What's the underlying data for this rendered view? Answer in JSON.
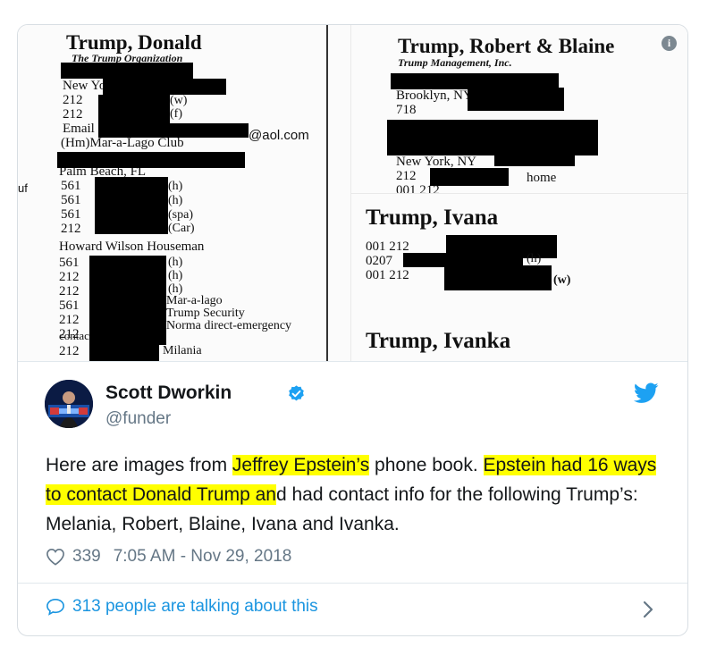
{
  "media": {
    "left": {
      "name": "Trump, Donald",
      "org": "The Trump Organization",
      "lines": [
        "New York, NY",
        "212",
        "212",
        "Email",
        "(Hm)Mar-a-Lago Club",
        "Palm Beach, FL",
        "561",
        "561",
        "561",
        "212",
        "Howard Wilson Houseman",
        "561",
        "212",
        "212",
        "561",
        "212",
        "212",
        "contact",
        "212"
      ],
      "tags": [
        "@aol.com",
        "(w)",
        "(f)",
        "(h)",
        "(h)",
        "(spa)",
        "(Car)",
        "(h)",
        "(h)",
        "(h)",
        "Mar-a-lago",
        "Trump Security",
        "Norma direct-emergency",
        "Milania"
      ],
      "margin": "uf"
    },
    "top_right": {
      "name": "Trump, Robert & Blaine",
      "org": "Trump Management, Inc.",
      "lines": [
        "Brooklyn, NY",
        "718",
        "New York, NY",
        "212",
        "001 212"
      ],
      "tags": [
        "home"
      ]
    },
    "bottom_right": {
      "name1": "Trump, Ivana",
      "lines": [
        "001 212",
        "0207",
        "001 212"
      ],
      "tags": [
        "(h)",
        "(w)"
      ],
      "name2": "Trump, Ivanka"
    },
    "info_glyph": "i"
  },
  "author": {
    "name": "Scott Dworkin",
    "handle": "@funder",
    "verified_color": "#1da1f2"
  },
  "tweet": {
    "p1": "Here are images from ",
    "h1": "Jeffrey Epstein’s",
    "p2": " phone book. ",
    "h2": "Epstein had 16 ways to contact Donald Trump an",
    "p3": "d had contact info for the following Trump’s: Melania, Robert, Blaine, Ivana and Ivanka."
  },
  "meta": {
    "likes": "339",
    "timestamp": "7:05 AM - Nov 29, 2018"
  },
  "footer": {
    "talking": "313 people are talking about this"
  },
  "colors": {
    "link": "#1b95e0",
    "muted": "#657786",
    "highlight": "#ffff00",
    "twitter_blue": "#1da1f2"
  },
  "icons": {
    "heart": "heart-icon",
    "bird": "twitter-bird-icon",
    "bubble": "speech-bubble-icon",
    "chevron": "chevron-right-icon",
    "verified": "verified-badge-icon",
    "info": "info-icon"
  }
}
